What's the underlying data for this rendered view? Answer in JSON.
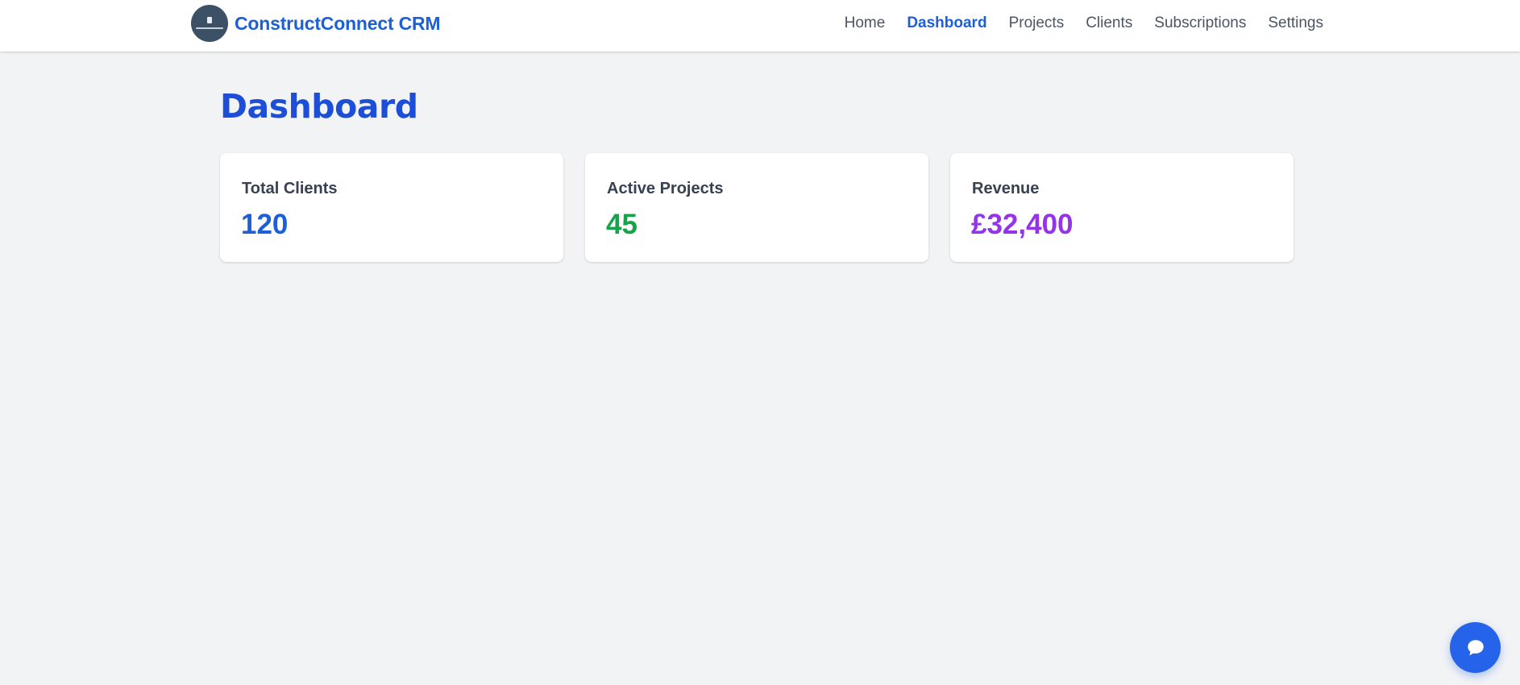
{
  "header": {
    "brand_name": "ConstructConnect CRM",
    "logo_icon": "building-logo-icon",
    "nav": [
      {
        "label": "Home",
        "active": false
      },
      {
        "label": "Dashboard",
        "active": true
      },
      {
        "label": "Projects",
        "active": false
      },
      {
        "label": "Clients",
        "active": false
      },
      {
        "label": "Subscriptions",
        "active": false
      },
      {
        "label": "Settings",
        "active": false
      }
    ]
  },
  "main": {
    "title": "Dashboard",
    "cards": [
      {
        "label": "Total Clients",
        "value": "120",
        "color": "#1d5fd6"
      },
      {
        "label": "Active Projects",
        "value": "45",
        "color": "#16a34a"
      },
      {
        "label": "Revenue",
        "value": "£32,400",
        "color": "#9333ea"
      }
    ]
  },
  "chat": {
    "icon": "chat-bubble-icon",
    "color": "#2563eb"
  }
}
